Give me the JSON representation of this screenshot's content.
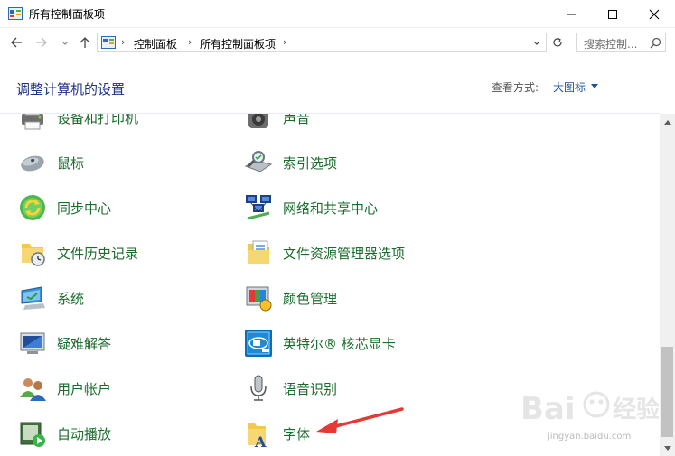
{
  "window": {
    "title": "所有控制面板项",
    "icons": {
      "app": "control-panel-icon",
      "minimize": "minimize-icon",
      "maximize": "maximize-icon",
      "close": "close-icon"
    }
  },
  "nav": {
    "breadcrumb": [
      "控制面板",
      "所有控制面板项"
    ],
    "search_placeholder": "搜索控制...",
    "icons": {
      "back": "arrow-left-icon",
      "forward": "arrow-right-icon",
      "recent": "chevron-down-icon",
      "up": "arrow-up-icon",
      "refresh": "refresh-icon",
      "search": "search-icon"
    }
  },
  "header": {
    "title": "调整计算机的设置",
    "view_label": "查看方式:",
    "view_value": "大图标"
  },
  "items_left": [
    {
      "label": "设备和打印机",
      "icon": "printer-icon"
    },
    {
      "label": "鼠标",
      "icon": "mouse-icon"
    },
    {
      "label": "同步中心",
      "icon": "sync-icon"
    },
    {
      "label": "文件历史记录",
      "icon": "file-history-icon"
    },
    {
      "label": "系统",
      "icon": "system-icon"
    },
    {
      "label": "疑难解答",
      "icon": "troubleshoot-icon"
    },
    {
      "label": "用户帐户",
      "icon": "user-accounts-icon"
    },
    {
      "label": "自动播放",
      "icon": "autoplay-icon"
    }
  ],
  "items_right": [
    {
      "label": "声音",
      "icon": "speaker-icon"
    },
    {
      "label": "索引选项",
      "icon": "indexing-icon"
    },
    {
      "label": "网络和共享中心",
      "icon": "network-icon"
    },
    {
      "label": "文件资源管理器选项",
      "icon": "folder-options-icon"
    },
    {
      "label": "颜色管理",
      "icon": "color-management-icon"
    },
    {
      "label": "英特尔® 核芯显卡",
      "icon": "intel-graphics-icon"
    },
    {
      "label": "语音识别",
      "icon": "microphone-icon"
    },
    {
      "label": "字体",
      "icon": "font-folder-icon"
    }
  ],
  "annotation": {
    "icon": "red-arrow-icon"
  },
  "watermark": {
    "logo": "Bai 经验",
    "url": "jingyan.baidu.com"
  },
  "colors": {
    "heading": "#1e3287",
    "item_text": "#1a6c2c",
    "link": "#1e50a0",
    "arrow": "#e53935"
  }
}
